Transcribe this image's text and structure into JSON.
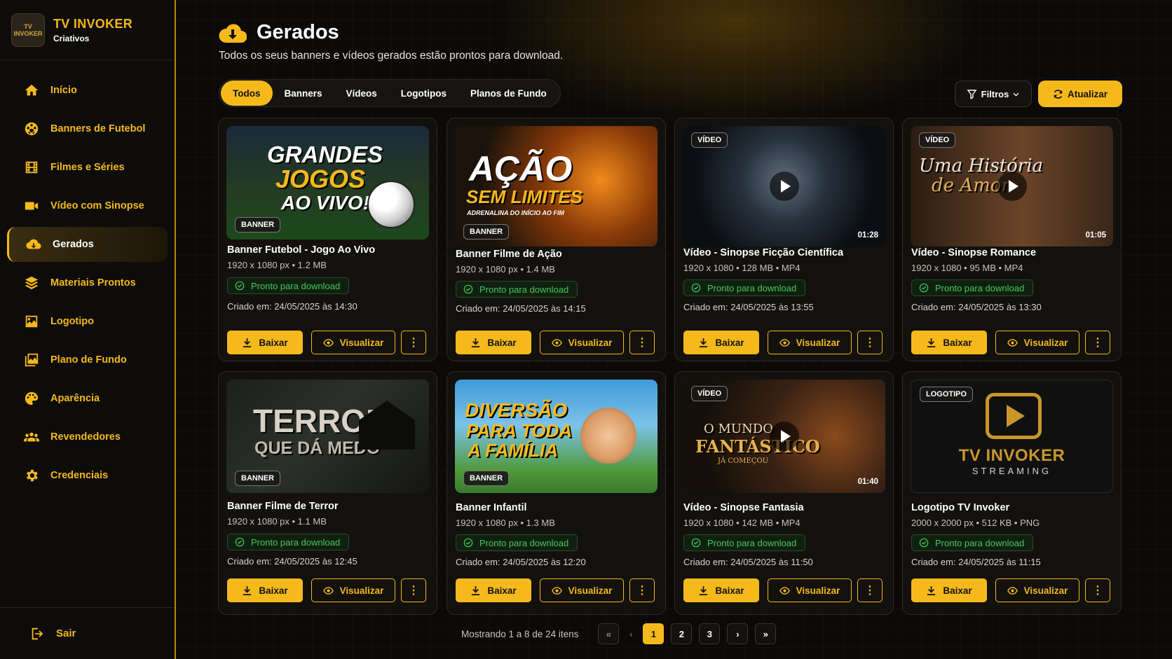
{
  "brand": {
    "title": "TV INVOKER",
    "subtitle": "Criativos",
    "logo_text": "TV INVOKER"
  },
  "sidebar": {
    "items": [
      {
        "label": "Início",
        "icon": "home-icon"
      },
      {
        "label": "Banners de Futebol",
        "icon": "soccer-ball-icon"
      },
      {
        "label": "Filmes e Séries",
        "icon": "film-icon"
      },
      {
        "label": "Vídeo com Sinopse",
        "icon": "video-camera-icon"
      },
      {
        "label": "Gerados",
        "icon": "cloud-download-icon",
        "active": true
      },
      {
        "label": "Materiais Prontos",
        "icon": "layers-icon"
      },
      {
        "label": "Logotipo",
        "icon": "image-icon"
      },
      {
        "label": "Plano de Fundo",
        "icon": "images-icon"
      },
      {
        "label": "Aparência",
        "icon": "palette-icon"
      },
      {
        "label": "Revendedores",
        "icon": "users-icon"
      },
      {
        "label": "Credenciais",
        "icon": "gear-icon"
      }
    ],
    "logout": "Sair"
  },
  "page": {
    "title": "Gerados",
    "subtitle": "Todos os seus banners e vídeos gerados estão prontos para download."
  },
  "tabs": [
    "Todos",
    "Banners",
    "Vídeos",
    "Logotipos",
    "Planos de Fundo"
  ],
  "toolbar": {
    "filter": "Filtros",
    "refresh": "Atualizar"
  },
  "cards": [
    {
      "title": "Banner Futebol - Jogo Ao Vivo",
      "meta": "1920 x 1080 px  •  1.2 MB",
      "status": "Pronto para download",
      "date": "Criado em: 24/05/2025 às 14:30",
      "badge": "BANNER",
      "thumb": {
        "lines": [
          "GRANDES",
          "JOGOS",
          "AO VIVO!"
        ]
      }
    },
    {
      "title": "Banner Filme de Ação",
      "meta": "1920 x 1080 px  •  1.4 MB",
      "status": "Pronto para download",
      "date": "Criado em: 24/05/2025 às 14:15",
      "badge": "BANNER",
      "thumb": {
        "lines": [
          "AÇÃO",
          "SEM LIMITES",
          "ADRENALINA DO INÍCIO AO FIM"
        ]
      }
    },
    {
      "title": "Vídeo - Sinopse Ficção Científica",
      "meta": "1920 x 1080  •  128 MB  •  MP4",
      "status": "Pronto para download",
      "date": "Criado em: 24/05/2025 às 13:55",
      "badge": "VÍDEO",
      "duration": "01:28"
    },
    {
      "title": "Vídeo - Sinopse Romance",
      "meta": "1920 x 1080  •  95 MB  •  MP4",
      "status": "Pronto para download",
      "date": "Criado em: 24/05/2025 às 13:30",
      "badge": "VÍDEO",
      "duration": "01:05",
      "thumb": {
        "lines": [
          "Uma História",
          "de Amor"
        ]
      }
    },
    {
      "title": "Banner Filme de Terror",
      "meta": "1920 x 1080 px  •  1.1 MB",
      "status": "Pronto para download",
      "date": "Criado em: 24/05/2025 às 12:45",
      "badge": "BANNER",
      "thumb": {
        "lines": [
          "TERROR",
          "QUE DÁ MEDO"
        ]
      }
    },
    {
      "title": "Banner Infantil",
      "meta": "1920 x 1080 px  •  1.3 MB",
      "status": "Pronto para download",
      "date": "Criado em: 24/05/2025 às 12:20",
      "badge": "BANNER",
      "thumb": {
        "lines": [
          "DIVERSÃO",
          "PARA TODA",
          "A FAMÍLIA"
        ]
      }
    },
    {
      "title": "Vídeo - Sinopse Fantasia",
      "meta": "1920 x 1080  •  142 MB  •  MP4",
      "status": "Pronto para download",
      "date": "Criado em: 24/05/2025 às 11:50",
      "badge": "VÍDEO",
      "duration": "01:40",
      "thumb": {
        "lines": [
          "O MUNDO",
          "FANTÁSTICO",
          "JÁ COMEÇOU"
        ]
      }
    },
    {
      "title": "Logotipo TV Invoker",
      "meta": "2000 x 2000 px  •  512 KB  •  PNG",
      "status": "Pronto para download",
      "date": "Criado em: 24/05/2025 às 11:15",
      "badge": "LOGOTIPO",
      "thumb": {
        "lines": [
          "TV INVOKER",
          "STREAMING"
        ]
      }
    }
  ],
  "card_actions": {
    "download": "Baixar",
    "view": "Visualizar",
    "more": "⋮"
  },
  "pagination": {
    "info": "Mostrando 1 a 8 de 24 itens",
    "pages": [
      "1",
      "2",
      "3"
    ],
    "current": "1",
    "first": "«",
    "prev": "‹",
    "next": "›",
    "last": "»"
  },
  "colors": {
    "accent": "#f5b91c",
    "background": "#0b0a08",
    "success": "#46c75c"
  }
}
